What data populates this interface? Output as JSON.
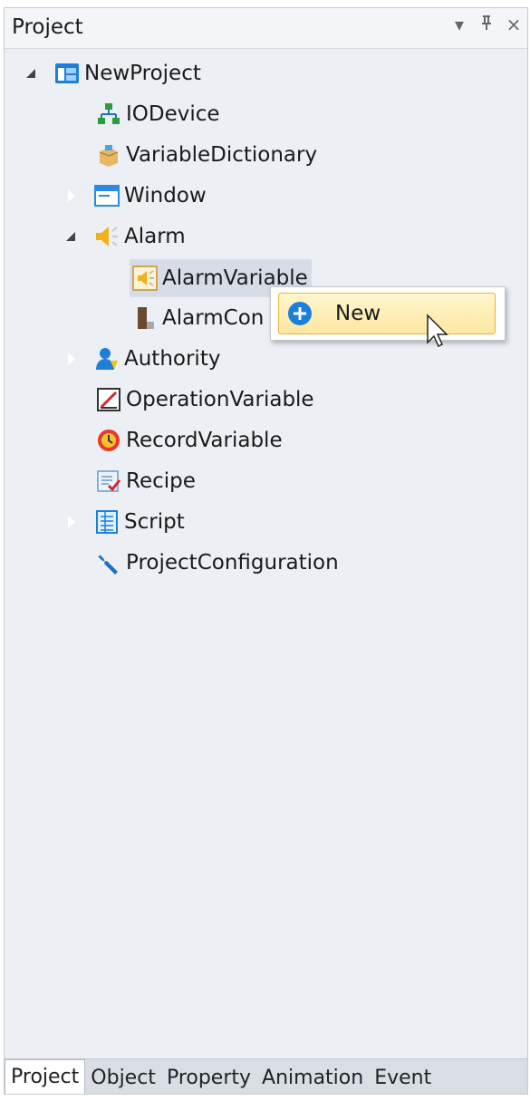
{
  "panel": {
    "title": "Project",
    "controls": {
      "dropdown": "▾",
      "pin": "⊥",
      "close": "×"
    }
  },
  "tree": {
    "root": {
      "label": "NewProject",
      "icon": "project-icon",
      "state": "expanded"
    },
    "items": [
      {
        "label": "IODevice",
        "icon": "network-icon"
      },
      {
        "label": "VariableDictionary",
        "icon": "dictionary-icon"
      },
      {
        "label": "Window",
        "icon": "window-icon",
        "state": "collapsed"
      },
      {
        "label": "Alarm",
        "icon": "alarm-icon",
        "state": "expanded",
        "children": [
          {
            "label": "AlarmVariable",
            "icon": "alarm-variable-icon",
            "selected": true
          },
          {
            "label": "AlarmCon",
            "icon": "alarm-config-icon"
          }
        ]
      },
      {
        "label": "Authority",
        "icon": "user-icon",
        "state": "collapsed"
      },
      {
        "label": "OperationVariable",
        "icon": "operation-icon"
      },
      {
        "label": "RecordVariable",
        "icon": "record-icon"
      },
      {
        "label": "Recipe",
        "icon": "recipe-icon"
      },
      {
        "label": "Script",
        "icon": "script-icon",
        "state": "collapsed"
      },
      {
        "label": "ProjectConfiguration",
        "icon": "wrench-icon"
      }
    ]
  },
  "context_menu": {
    "items": [
      {
        "label": "New",
        "icon": "plus-circle-icon"
      }
    ]
  },
  "bottom_tabs": [
    {
      "label": "Project",
      "active": true
    },
    {
      "label": "Object"
    },
    {
      "label": "Property"
    },
    {
      "label": "Animation"
    },
    {
      "label": "Event"
    }
  ],
  "colors": {
    "accent_blue": "#1e7fd8",
    "highlight": "#fde8a0",
    "selection": "#d7dde6"
  }
}
